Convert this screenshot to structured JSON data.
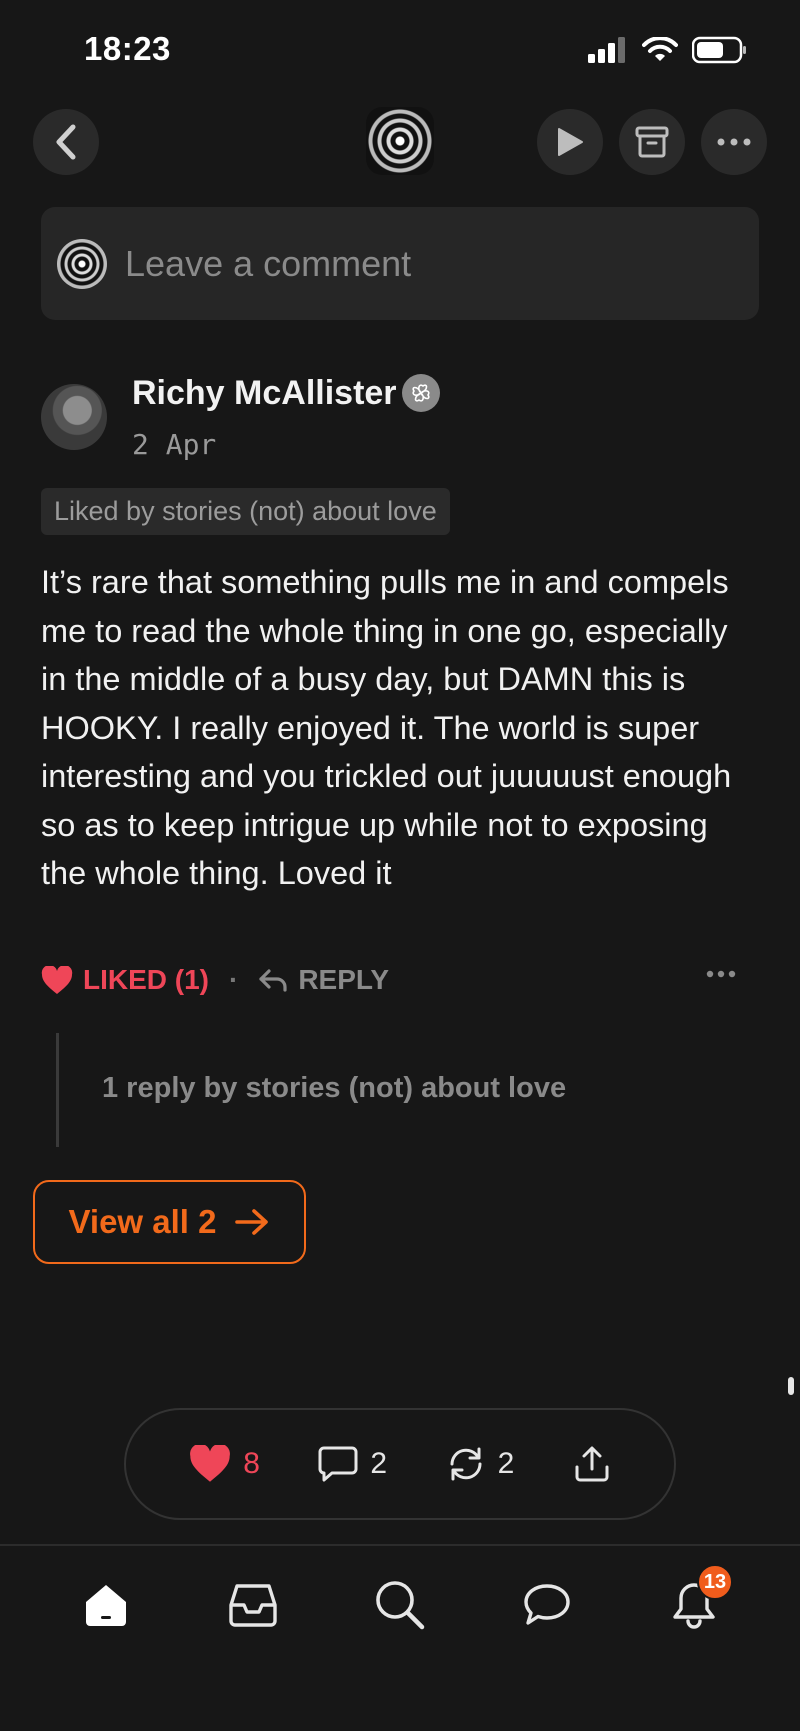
{
  "status_bar": {
    "time": "18:23"
  },
  "header": {
    "back_icon": "chevron-left-icon",
    "play_icon": "play-icon",
    "archive_icon": "archive-icon",
    "more_icon": "more-icon"
  },
  "comment_input": {
    "placeholder": "Leave a comment"
  },
  "comment": {
    "author": "Richy McAllister",
    "date": "2 Apr",
    "liked_by": "Liked by stories (not) about love",
    "body": "It’s rare that something pulls me in and compels me to read the whole thing in one go, especially in the middle of a busy day, but DAMN this is HOOKY. I really enjoyed it. The world is super interesting and you trickled out juuuuust enough so as to keep intrigue up while not to exposing the whole thing. Loved it",
    "liked_label": "LIKED (1)",
    "separator": "·",
    "reply_label": "REPLY",
    "replies_summary": "1 reply by stories (not) about love"
  },
  "view_all": {
    "label": "View all 2"
  },
  "stats": {
    "likes": "8",
    "comments": "2",
    "restacks": "2"
  },
  "bottom_nav": {
    "items": [
      "home-icon",
      "inbox-icon",
      "search-icon",
      "chat-icon",
      "bell-icon"
    ],
    "notification_count": "13"
  },
  "colors": {
    "accent": "#f26a1b",
    "like": "#ef4658",
    "background": "#171717"
  }
}
